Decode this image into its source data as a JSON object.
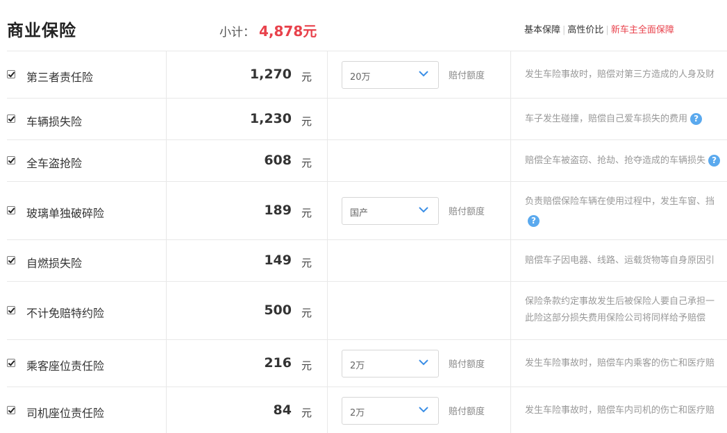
{
  "header": {
    "title": "商业保险",
    "subtotal_label": "小计：",
    "subtotal_value": "4,878元",
    "plans": [
      "基本保障",
      "高性价比",
      "新车主全面保障"
    ],
    "separator": "|"
  },
  "colors": {
    "accent_red": "#e8414b",
    "help_blue": "#5aa9ee"
  },
  "unit_label": "元",
  "amount_label": "赔付额度",
  "rows": [
    {
      "checked": true,
      "name": "第三者责任险",
      "price": "1,270",
      "coverage": "20万",
      "desc_lines": [
        "发生车险事故时，赔偿对第三方造成的人身及财"
      ]
    },
    {
      "checked": true,
      "name": "车辆损失险",
      "price": "1,230",
      "coverage": null,
      "desc_lines": [
        "车子发生碰撞，赔偿自己爱车损失的费用"
      ]
    },
    {
      "checked": true,
      "name": "全车盗抢险",
      "price": "608",
      "coverage": null,
      "desc_lines": [
        "赔偿全车被盗窃、抢劫、抢夺造成的车辆损失"
      ]
    },
    {
      "checked": true,
      "name": "玻璃单独破碎险",
      "price": "189",
      "coverage": "国产",
      "desc_lines": [
        "负责赔偿保险车辆在使用过程中，发生车窗、挡"
      ]
    },
    {
      "checked": true,
      "name": "自燃损失险",
      "price": "149",
      "coverage": null,
      "desc_lines": [
        "赔偿车子因电器、线路、运载货物等自身原因引"
      ]
    },
    {
      "checked": true,
      "name": "不计免赔特约险",
      "price": "500",
      "coverage": null,
      "desc_lines": [
        "保险条款约定事故发生后被保险人要自己承担一",
        "此险这部分损失费用保险公司将同样给予赔偿"
      ]
    },
    {
      "checked": true,
      "name": "乘客座位责任险",
      "price": "216",
      "coverage": "2万",
      "desc_lines": [
        "发生车险事故时，赔偿车内乘客的伤亡和医疗赔"
      ]
    },
    {
      "checked": true,
      "name": "司机座位责任险",
      "price": "84",
      "coverage": "2万",
      "desc_lines": [
        "发生车险事故时，赔偿车内司机的伤亡和医疗赔"
      ]
    }
  ]
}
